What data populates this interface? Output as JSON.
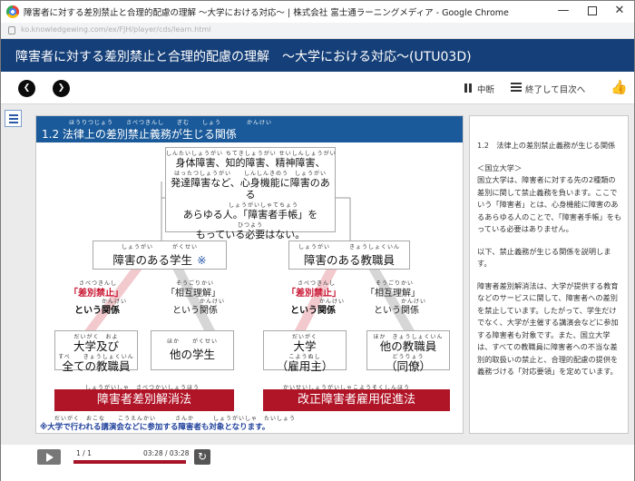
{
  "window": {
    "title": "障害者に対する差別禁止と合理的配慮の理解 〜大学における対応〜 | 株式会社 富士通ラーニングメディア - Google Chrome",
    "url": "ko.knowledgewing.com/ex/FJH/player/cds/learn.html"
  },
  "header": {
    "course_title": "障害者に対する差別禁止と合理的配慮の理解　〜大学における対応〜(UTU03D)"
  },
  "nav": {
    "prev_symbol": "❮",
    "next_symbol": "❯",
    "pause_label": "中断",
    "toc_label": "終了して目次へ",
    "like_symbol": "👍"
  },
  "slide": {
    "title": "1.2  法律上の差別禁止義務が生じる関係",
    "title_ruby": "ほうりつじょう　　さべつきんし　　ぎむ　　しょう　　　　かんけい",
    "top_box_ruby1": "しんたいしょうがい ちてきしょうがい せいしんしょうがい",
    "top_box_line1": "身体障害、知的障害、精神障害、",
    "top_box_ruby2": "はったつしょうがい　　しんしんきのう　しょうがい",
    "top_box_line2": "発達障害など、心身機能に障害のある",
    "top_box_ruby3": "しょうがいしゃてちょう",
    "top_box_line3": "あらゆる人。「障害者手帳」を",
    "top_box_ruby4": "ひつよう",
    "top_box_line4": "もっている必要はない。",
    "left_box_ruby": "しょうがい　　　がくせい",
    "left_box": "障害のある学生",
    "star": "※",
    "right_box_ruby": "しょうがい　　　きょうしょくいん",
    "right_box": "障害のある教職員",
    "rel1_ruby": "さべつきんし",
    "rel1": "「差別禁止」",
    "rel1_ruby_b": "かんけい",
    "rel1_sub": "という関係",
    "rel2_ruby": "そうごりかい",
    "rel2": "「相互理解」",
    "rel2_ruby_b": "かんけい",
    "rel2_sub": "という関係",
    "rel3_ruby": "さべつきんし",
    "rel3": "「差別禁止」",
    "rel3_ruby_b": "かんけい",
    "rel3_sub": "という関係",
    "rel4_ruby": "そうごりかい",
    "rel4": "「相互理解」",
    "rel4_ruby_b": "かんけい",
    "rel4_sub": "という関係",
    "b1_ruby1": "だいがく　およ",
    "b1_line1": "大学及び",
    "b1_ruby2": "すべ　　きょうしょくいん",
    "b1_line2": "全ての教職員",
    "b2_ruby": "ほか　　がくせい",
    "b2": "他の学生",
    "b3_ruby1": "だいがく",
    "b3_line1": "大学",
    "b3_ruby2": "こようぬし",
    "b3_line2": "（雇用主）",
    "b4_ruby1": "ほか　きょうしょくいん",
    "b4_line1": "他の教職員",
    "b4_ruby2": "どうりょう",
    "b4_line2": "（同僚）",
    "banner1_ruby": "しょうがいしゃ　さべつかいしょうほう",
    "banner1": "障害者差別解消法",
    "banner2_ruby": "かいせいしょうがいしゃこようそくしんほう",
    "banner2": "改正障害者雇用促進法",
    "note_ruby": "だいがく　おこな　　こうえんかい　　　さんか　　　しょうがいしゃ　たいしょう",
    "note": "※大学で行われる講演会などに参加する障害者も対象となります。"
  },
  "sidebar": {
    "heading": "1.2　法律上の差別禁止義務が生じる関係",
    "section": "＜国立大学＞",
    "p1": "国立大学は、障害者に対する先の2種類の差別に関して禁止義務を負います。ここでいう「障害者」とは、心身機能に障害のあるあらゆる人のことで、「障害者手帳」をもっている必要はありません。",
    "p2": "以下、禁止義務が生じる関係を説明します。",
    "p3": "障害者差別解消法は、大学が提供する教育などのサービスに関して、障害者への差別を禁止しています。したがって、学生だけでなく、大学が主催する講演会などに参加する障害者も対象です。また、国立大学は、すべての教職員に障害者への不当な差別的取扱いの禁止と、合理的配慮の提供を義務づける「対応要領」を定めています。"
  },
  "player": {
    "page_count": "1 / 1",
    "time": "03:28 / 03:28",
    "progress": 1.0,
    "replay_symbol": "↻"
  },
  "colors": {
    "header_bg": "#153f78",
    "slide_header_bg": "#1a5a9a",
    "banner_red": "#b01427",
    "rel_red": "#c8102e",
    "progress_fill": "#a71428"
  }
}
